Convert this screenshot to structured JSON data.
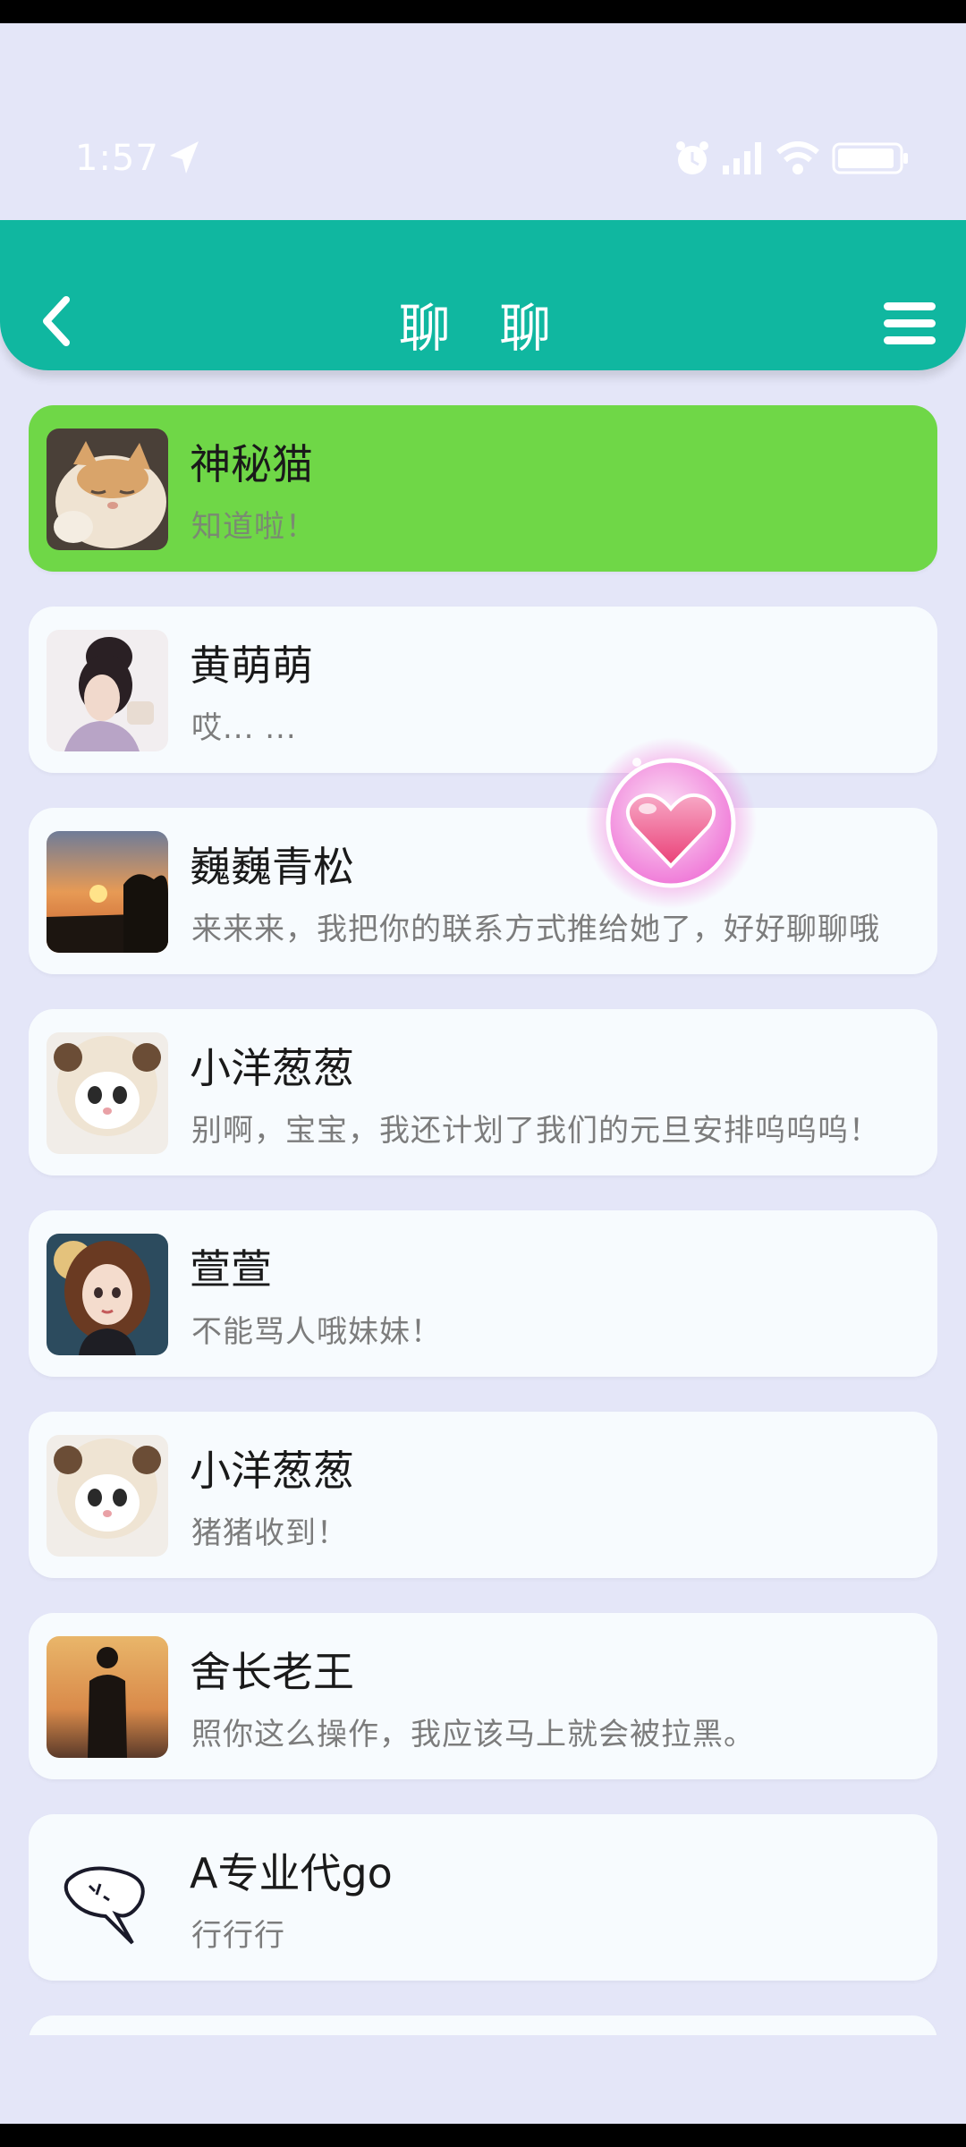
{
  "status_bar": {
    "time": "1:57"
  },
  "header": {
    "title": "聊 聊"
  },
  "chats": [
    {
      "name": "神秘猫",
      "message": "知道啦！",
      "active": true,
      "avatar": "cat-avatar"
    },
    {
      "name": "黄萌萌",
      "message": "哎... ...",
      "active": false,
      "avatar": "girl-avatar"
    },
    {
      "name": "巍巍青松",
      "message": "来来来，我把你的联系方式推给她了，好好聊聊哦",
      "active": false,
      "avatar": "sunset-avatar"
    },
    {
      "name": "小洋葱葱",
      "message": "别啊，宝宝，我还计划了我们的元旦安排呜呜呜！",
      "active": false,
      "avatar": "sheep-cat-avatar"
    },
    {
      "name": "萱萱",
      "message": "不能骂人哦妹妹！",
      "active": false,
      "avatar": "cartoon-girl-avatar"
    },
    {
      "name": "小洋葱葱",
      "message": "猪猪收到！",
      "active": false,
      "avatar": "sheep-cat-avatar"
    },
    {
      "name": "舍长老王",
      "message": "照你这么操作，我应该马上就会被拉黑。",
      "active": false,
      "avatar": "silhouette-avatar"
    },
    {
      "name": "A专业代go",
      "message": "行行行",
      "active": false,
      "avatar": "doodle-avatar"
    }
  ],
  "colors": {
    "background": "#e4e6f8",
    "header": "#10b7a0",
    "active_item": "#6fd747",
    "item": "#f7fbfe"
  }
}
